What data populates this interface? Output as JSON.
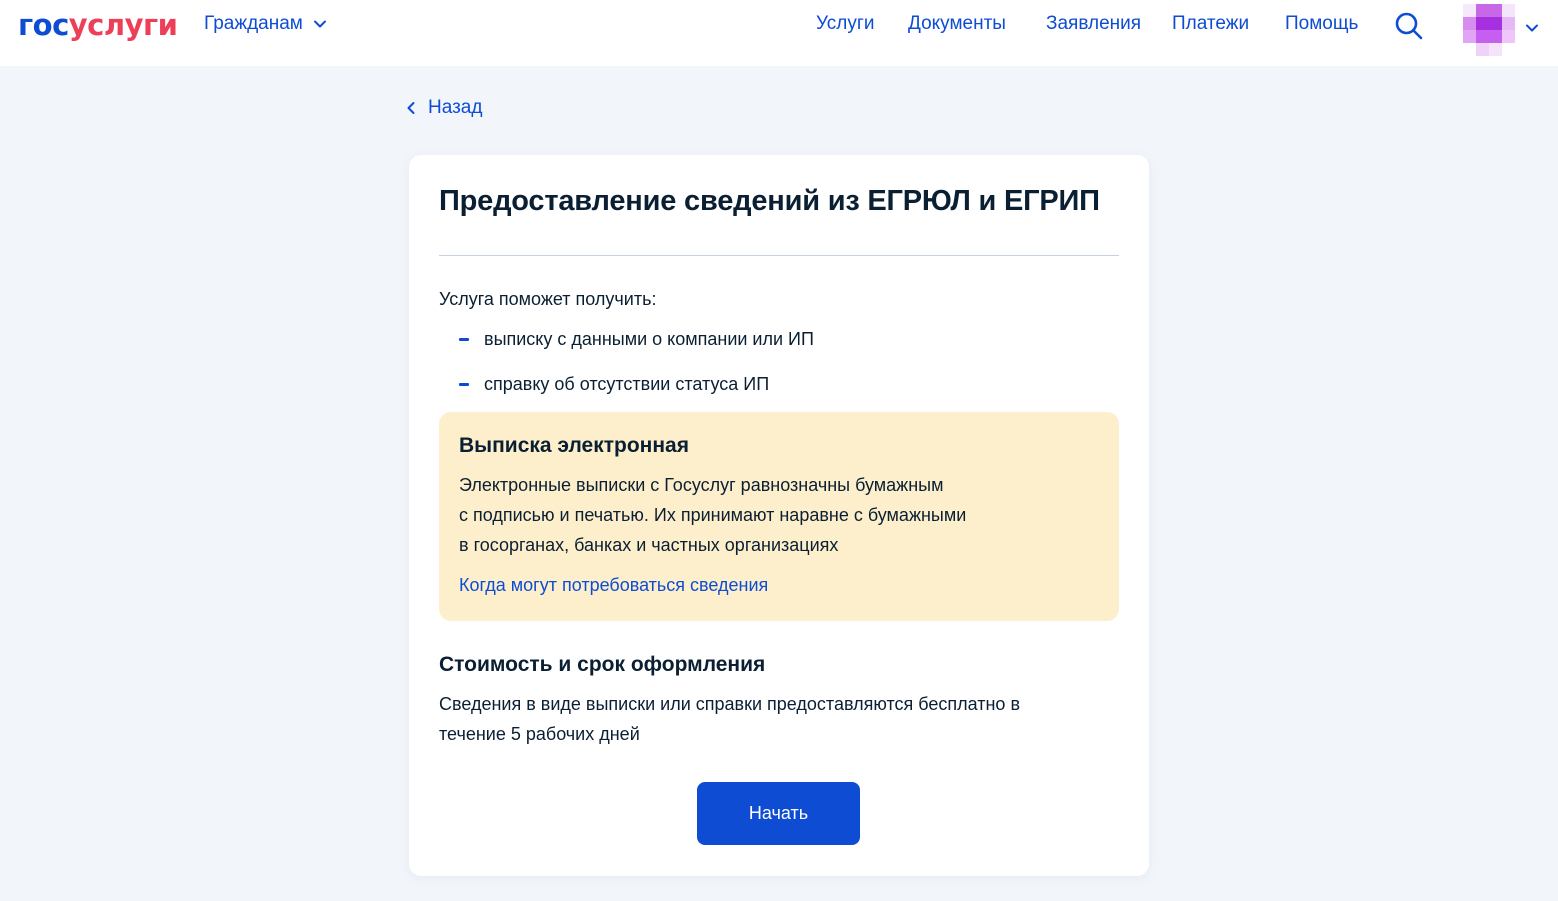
{
  "header": {
    "logo": {
      "part1": "гос",
      "part2": "услуги"
    },
    "citizens_label": "Гражданам",
    "nav": [
      {
        "label": "Услуги"
      },
      {
        "label": "Документы"
      },
      {
        "label": "Заявления"
      },
      {
        "label": "Платежи"
      },
      {
        "label": "Помощь"
      }
    ],
    "search_icon": "search-icon",
    "avatar_icon": "avatar"
  },
  "back": {
    "label": "Назад"
  },
  "card": {
    "title": "Предоставление сведений из ЕГРЮЛ и ЕГРИП",
    "intro": "Услуга поможет получить:",
    "bullets": [
      "выписку с данными о компании или ИП",
      "справку об отсутствии статуса ИП"
    ],
    "notice": {
      "title": "Выписка электронная",
      "lines": [
        "Электронные выписки с Госуслуг равнозначны бумажным",
        "с подписью и печатью. Их принимают наравне с бумажными",
        "в госорганах, банках и частных организациях"
      ],
      "link": "Когда могут потребоваться сведения"
    },
    "cost": {
      "title": "Стоимость и срок оформления",
      "lines": [
        "Сведения в виде выписки или справки предоставляются бесплатно в",
        "течение 5 рабочих дней"
      ]
    },
    "start_button": "Начать"
  },
  "colors": {
    "brand_blue": "#0d4cd3",
    "brand_red": "#ee3f58",
    "page_bg": "#f2f5fa",
    "notice_bg": "#fdefcc"
  }
}
